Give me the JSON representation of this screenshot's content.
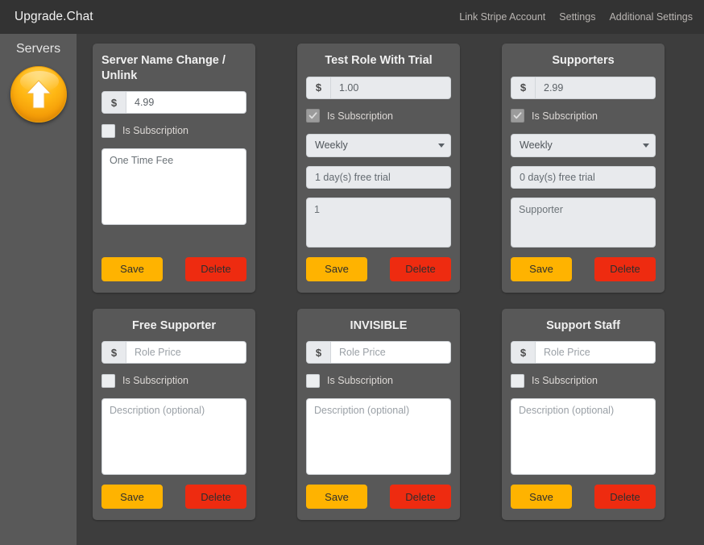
{
  "header": {
    "brand": "Upgrade.Chat",
    "nav": [
      {
        "label": "Link Stripe Account",
        "name": "nav-link-stripe"
      },
      {
        "label": "Settings",
        "name": "nav-link-settings"
      },
      {
        "label": "Additional Settings",
        "name": "nav-link-additional-settings"
      }
    ]
  },
  "sidebar": {
    "title": "Servers",
    "server_button": {
      "icon": "arrow-up-icon",
      "color": "#ffb713"
    }
  },
  "labels": {
    "is_subscription": "Is Subscription",
    "save": "Save",
    "delete": "Delete",
    "price_prefix": "$",
    "price_placeholder": "Role Price",
    "description_placeholder": "Description (optional)"
  },
  "colors": {
    "header_bg": "#333333",
    "sidebar_bg": "#595959",
    "content_bg": "#3d3d3d",
    "card_bg": "#585858",
    "save": "#ffb300",
    "delete": "#ee2b10",
    "input_bg": "#ffffff",
    "input_bg_disabled": "#e8eaed"
  },
  "cards": [
    {
      "title": "Server Name Change / Unlink",
      "title_wrapped": true,
      "price_value": "4.99",
      "price_placeholder": "",
      "is_subscription": false,
      "interval": null,
      "trial": null,
      "description_value": "One Time Fee",
      "description_placeholder": ""
    },
    {
      "title": "Test Role With Trial",
      "title_wrapped": false,
      "price_value": "1.00",
      "price_placeholder": "",
      "is_subscription": true,
      "interval": "Weekly",
      "trial": "1 day(s) free trial",
      "description_value": "1",
      "description_placeholder": ""
    },
    {
      "title": "Supporters",
      "title_wrapped": false,
      "price_value": "2.99",
      "price_placeholder": "",
      "is_subscription": true,
      "interval": "Weekly",
      "trial": "0 day(s) free trial",
      "description_value": "Supporter",
      "description_placeholder": ""
    },
    {
      "title": "Free Supporter",
      "title_wrapped": false,
      "price_value": "",
      "price_placeholder": "Role Price",
      "is_subscription": false,
      "interval": null,
      "trial": null,
      "description_value": "",
      "description_placeholder": "Description (optional)"
    },
    {
      "title": "INVISIBLE",
      "title_wrapped": false,
      "price_value": "",
      "price_placeholder": "Role Price",
      "is_subscription": false,
      "interval": null,
      "trial": null,
      "description_value": "",
      "description_placeholder": "Description (optional)"
    },
    {
      "title": "Support Staff",
      "title_wrapped": false,
      "price_value": "",
      "price_placeholder": "Role Price",
      "is_subscription": false,
      "interval": null,
      "trial": null,
      "description_value": "",
      "description_placeholder": "Description (optional)"
    }
  ]
}
